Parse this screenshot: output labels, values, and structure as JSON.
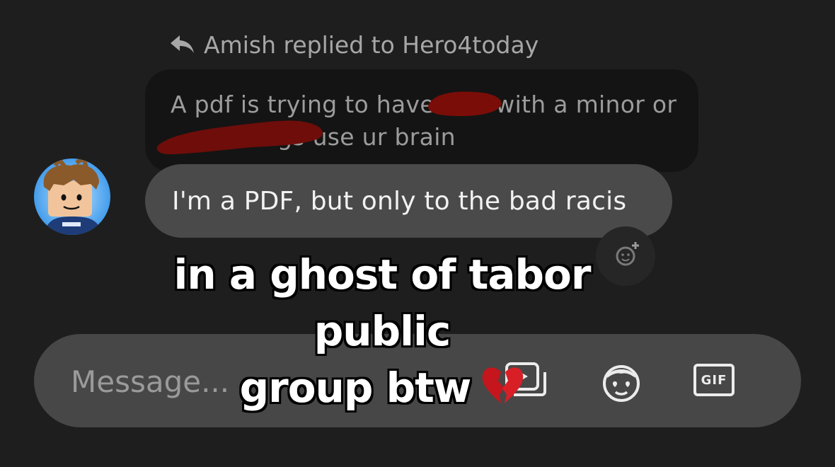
{
  "reply_header": {
    "icon": "reply-arrow-icon",
    "text": "Amish replied to Hero4today"
  },
  "quoted_message": {
    "line1": "A pdf is trying to have        with a minor or",
    "line2": "              gs use ur brain",
    "redaction_color": "#7b0d08"
  },
  "message": {
    "text": "I'm a PDF, but only to the bad racis",
    "avatar": "user-avatar-cartoon"
  },
  "reaction_button": {
    "icon": "add-reaction-icon"
  },
  "caption": {
    "line1": "in a ghost of tabor public",
    "line2": "group btw",
    "emoji": "broken-heart-icon"
  },
  "composer": {
    "placeholder": "Message...",
    "icons": [
      "media-icon",
      "emote-icon",
      "gif-icon"
    ],
    "gif_label": "GIF"
  },
  "colors": {
    "background": "#1e1e1e",
    "quoted_bubble": "#141414",
    "message_bubble": "#4a4a4a",
    "composer": "#474747"
  }
}
